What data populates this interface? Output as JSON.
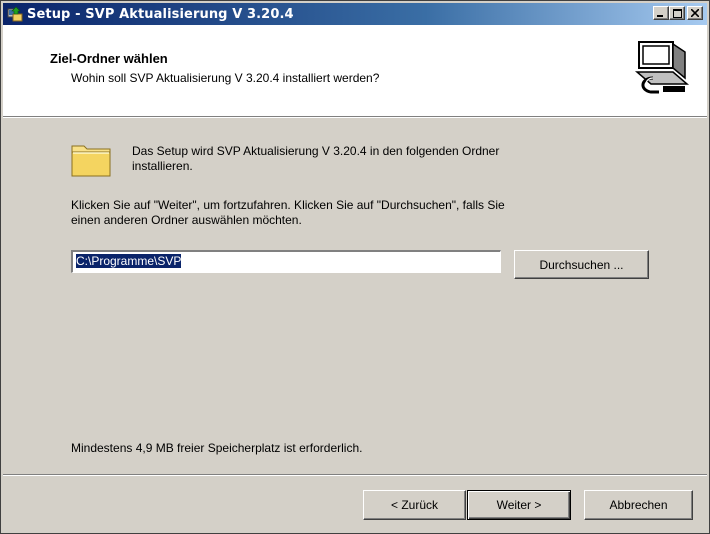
{
  "window": {
    "title": "Setup - SVP Aktualisierung V 3.20.4",
    "minimize_icon": "minimize-icon",
    "maximize_icon": "maximize-icon",
    "close_icon": "close-icon"
  },
  "header": {
    "title": "Ziel-Ordner wählen",
    "subtitle": "Wohin soll SVP Aktualisierung V 3.20.4 installiert werden?",
    "icon": "install-computer-icon"
  },
  "body": {
    "folder_icon": "folder-icon",
    "intro_line1": "Das Setup wird SVP Aktualisierung V 3.20.4 in den folgenden Ordner",
    "intro_line2": "installieren.",
    "instruction_line1": "Klicken Sie auf \"Weiter\", um fortzufahren. Klicken Sie auf \"Durchsuchen\", falls Sie",
    "instruction_line2": "einen anderen Ordner auswählen möchten.",
    "path_value": "C:\\Programme\\SVP",
    "browse_label": "Durchsuchen ...",
    "space_required": "Mindestens 4,9 MB freier Speicherplatz ist erforderlich."
  },
  "footer": {
    "back_label": "< Zurück",
    "next_label": "Weiter >",
    "cancel_label": "Abbrechen"
  }
}
